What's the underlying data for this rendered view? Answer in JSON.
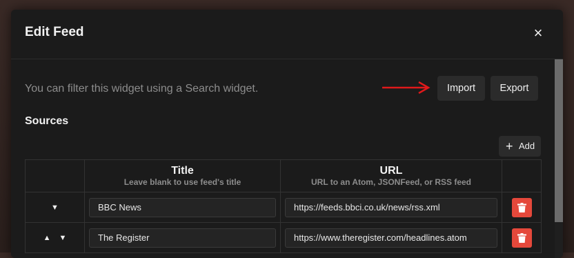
{
  "dialog": {
    "title": "Edit Feed",
    "close_glyph": "×"
  },
  "hint": "You can filter this widget using a Search widget.",
  "toolbar": {
    "import_label": "Import",
    "export_label": "Export"
  },
  "sources": {
    "heading": "Sources",
    "add_label": "Add",
    "add_icon": "+",
    "columns": [
      {
        "title": "Title",
        "subtitle": "Leave blank to use feed's title"
      },
      {
        "title": "URL",
        "subtitle": "URL to an Atom, JSONFeed, or RSS feed"
      }
    ],
    "rows": [
      {
        "title": "BBC News",
        "url": "https://feeds.bbci.co.uk/news/rss.xml",
        "can_move_up": false,
        "can_move_down": true
      },
      {
        "title": "The Register",
        "url": "https://www.theregister.com/headlines.atom",
        "can_move_up": true,
        "can_move_down": true
      }
    ]
  },
  "colors": {
    "accent_arrow": "#e0191b",
    "delete_button": "#e5483b"
  },
  "icons": {
    "up": "▲",
    "down": "▼"
  }
}
